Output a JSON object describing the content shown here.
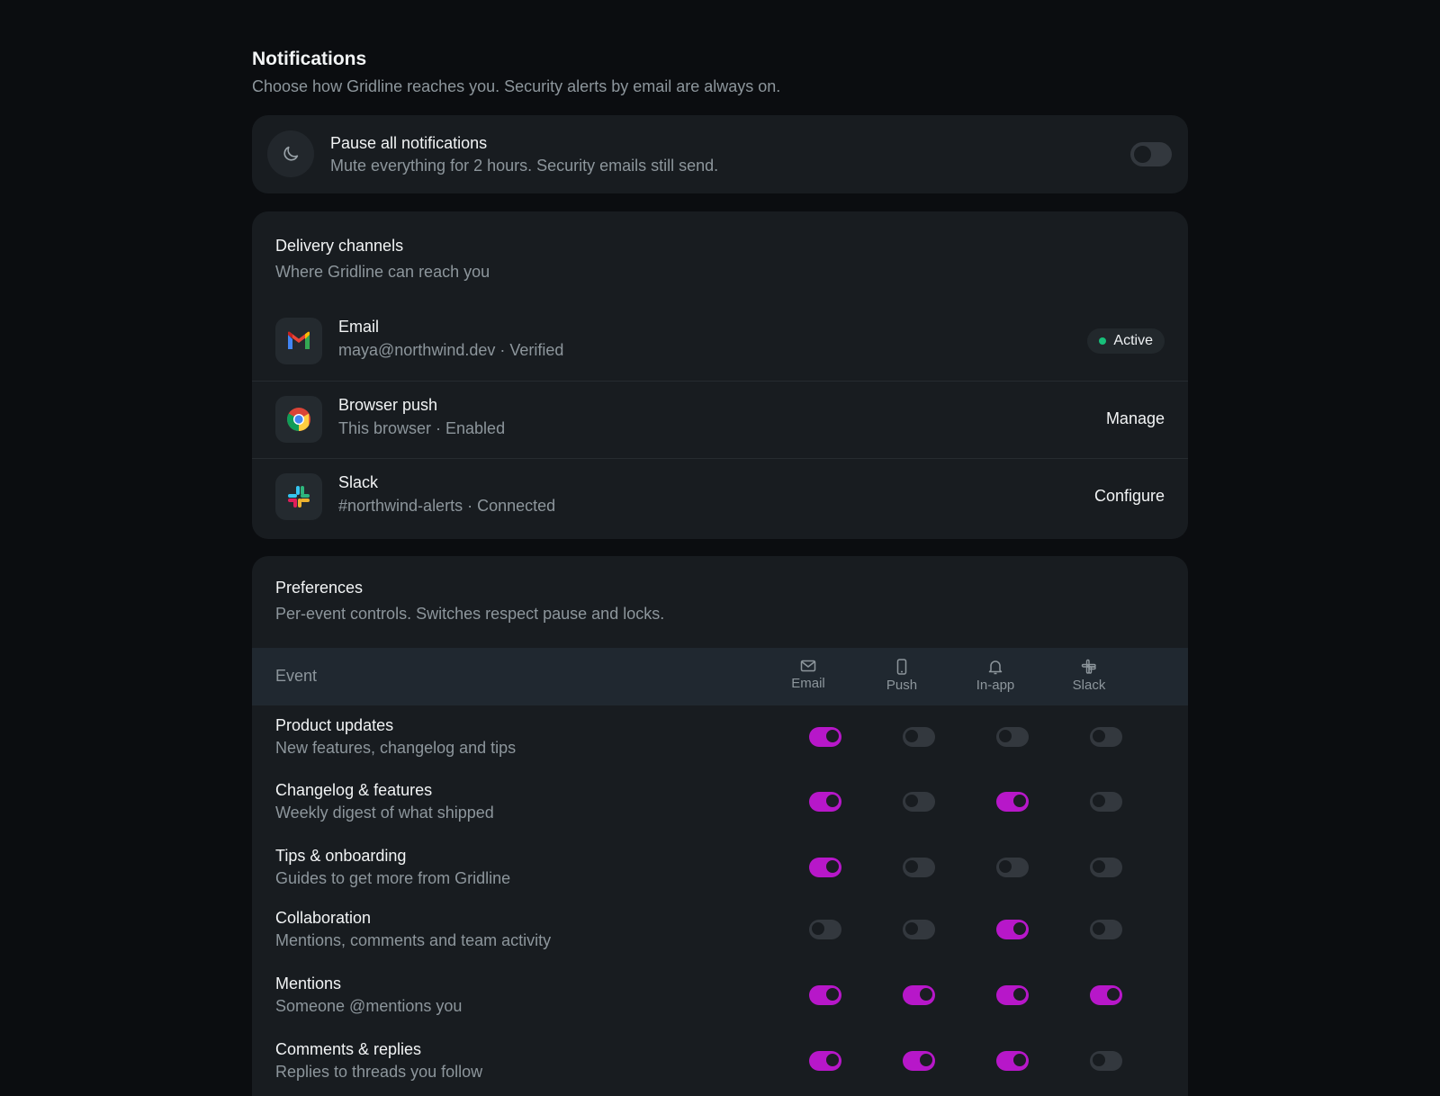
{
  "page": {
    "title": "Notifications",
    "subtitle": "Choose how Gridline reaches you. Security alerts by email are always on."
  },
  "pause": {
    "icon": "moon-icon",
    "title": "Pause all notifications",
    "subtitle": "Mute everything for 2 hours. Security emails still send.",
    "enabled": false
  },
  "channels": {
    "title": "Delivery channels",
    "subtitle": "Where Gridline can reach you",
    "items": [
      {
        "icon": "gmail-icon",
        "title": "Email",
        "subtitle": "maya@northwind.dev · Verified",
        "badge": "Active"
      },
      {
        "icon": "chrome-icon",
        "title": "Browser push",
        "subtitle": "This browser · Enabled",
        "action": "Manage"
      },
      {
        "icon": "slack-icon",
        "title": "Slack",
        "subtitle": "#northwind-alerts · Connected",
        "action": "Configure"
      }
    ]
  },
  "preferences": {
    "title": "Preferences",
    "subtitle": "Per-event controls. Switches respect pause and locks.",
    "event_header": "Event",
    "columns": [
      {
        "label": "Email",
        "icon": "mail-icon"
      },
      {
        "label": "Push",
        "icon": "phone-icon"
      },
      {
        "label": "In-app",
        "icon": "bell-icon"
      },
      {
        "label": "Slack",
        "icon": "slack-mono-icon"
      }
    ],
    "rows": [
      {
        "title": "Product updates",
        "subtitle": "New features, changelog and tips",
        "toggles": [
          true,
          false,
          false,
          false
        ]
      },
      {
        "title": "Changelog & features",
        "subtitle": "Weekly digest of what shipped",
        "toggles": [
          true,
          false,
          true,
          false
        ]
      },
      {
        "title": "Tips & onboarding",
        "subtitle": "Guides to get more from Gridline",
        "toggles": [
          true,
          false,
          false,
          false
        ]
      },
      {
        "title": "Collaboration",
        "subtitle": "Mentions, comments and team activity",
        "toggles": [
          false,
          false,
          true,
          false
        ]
      },
      {
        "title": "Mentions",
        "subtitle": "Someone @mentions you",
        "toggles": [
          true,
          true,
          true,
          true
        ]
      },
      {
        "title": "Comments & replies",
        "subtitle": "Replies to threads you follow",
        "toggles": [
          true,
          true,
          true,
          false
        ]
      }
    ]
  },
  "colors": {
    "accent": "#b717c9",
    "active_dot": "#18c07a"
  }
}
